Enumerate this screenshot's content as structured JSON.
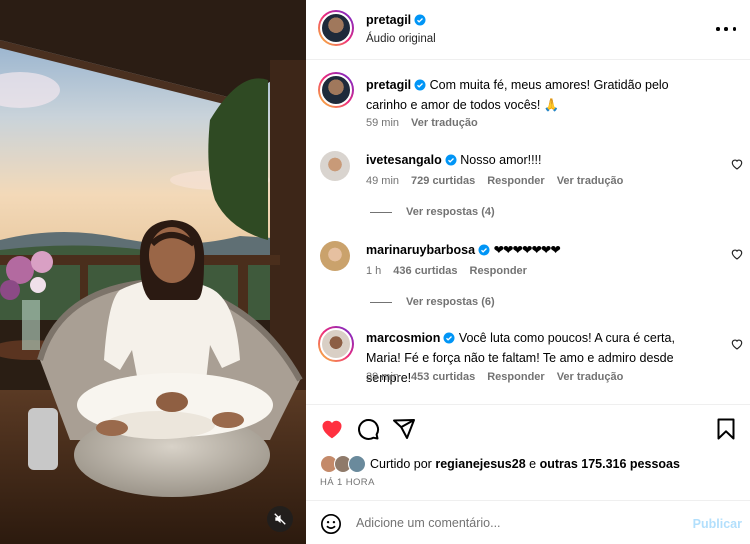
{
  "post": {
    "username": "pretagil",
    "audio": "Áudio original"
  },
  "caption": {
    "username": "pretagil",
    "text": "Com muita fé, meus amores! Gratidão pelo carinho e amor de todos vocês! 🙏",
    "time": "59 min",
    "translate": "Ver tradução"
  },
  "comments": [
    {
      "username": "ivetesangalo",
      "text": "Nosso amor!!!!",
      "time": "49 min",
      "likes": "729 curtidas",
      "reply": "Responder",
      "translate": "Ver tradução",
      "replies": "Ver respostas (4)"
    },
    {
      "username": "marinaruybarbosa",
      "text": "❤❤❤❤❤❤❤",
      "time": "1 h",
      "likes": "436 curtidas",
      "reply": "Responder",
      "replies": "Ver respostas (6)"
    },
    {
      "username": "marcosmion",
      "text": "Você luta como poucos! A cura é certa, Maria! Fé e força não te faltam! Te amo e admiro desde sempre!",
      "time": "39 min",
      "likes": "453 curtidas",
      "reply": "Responder",
      "translate": "Ver tradução"
    }
  ],
  "likes": {
    "prefix": "Curtido por",
    "user": "regianejesus28",
    "middle": "e",
    "rest": "outras 175.316 pessoas"
  },
  "posted": "HÁ 1 HORA",
  "composer": {
    "placeholder": "Adicione um comentário...",
    "publish": "Publicar"
  },
  "icons": {
    "more": "more-horizontal-icon",
    "verified": "verified-badge-icon",
    "like": "heart-filled-icon",
    "comment": "comment-bubble-icon",
    "share": "paper-plane-icon",
    "save": "bookmark-icon",
    "emoji": "emoji-smile-icon",
    "mute": "speaker-muted-icon"
  },
  "colors": {
    "like_red": "#ff3040",
    "verified_blue": "#0095f6",
    "publish_disabled": "#b2dffc",
    "secondary_text": "#737373"
  }
}
